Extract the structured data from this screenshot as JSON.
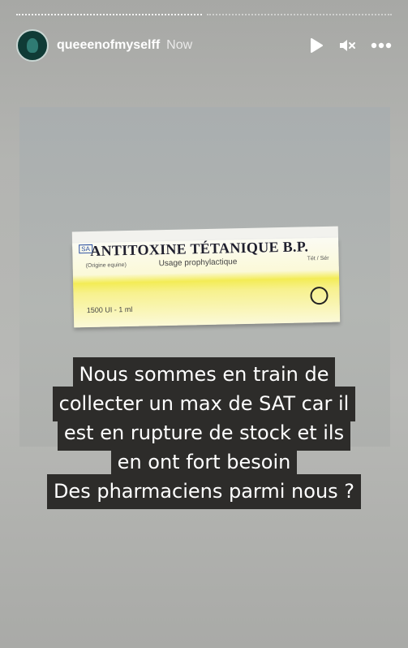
{
  "story": {
    "username": "queeenofmyselff",
    "time": "Now"
  },
  "controls": {
    "play_icon": "play-icon",
    "mute_icon": "muted-speaker-icon",
    "more_icon": "more-options-icon"
  },
  "photo": {
    "box_brand_badge": "SA",
    "box_title": "ANTITOXINE TÉTANIQUE B.P.",
    "box_origin": "(Origine equine)",
    "box_usage": "Usage prophylactique",
    "box_tag": "Tét / Sér",
    "box_dose": "1500 UI - 1 ml"
  },
  "caption": {
    "lines": [
      "Nous sommes en train de",
      "collecter un max de SAT car il",
      "est en rupture de stock et ils",
      "en ont fort besoin",
      "Des pharmaciens parmi nous ?"
    ]
  }
}
